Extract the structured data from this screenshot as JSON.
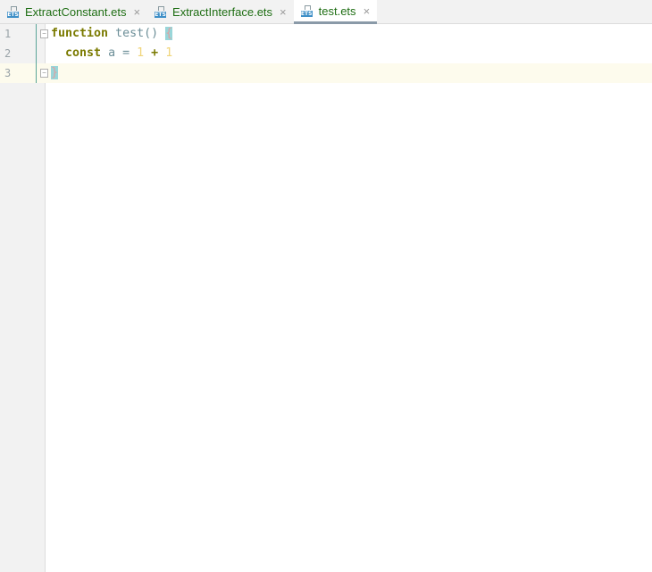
{
  "tabs": [
    {
      "label": "ExtractConstant.ets",
      "icon": "ets-file-icon",
      "active": false
    },
    {
      "label": "ExtractInterface.ets",
      "icon": "ets-file-icon",
      "active": false
    },
    {
      "label": "test.ets",
      "icon": "ets-file-icon",
      "active": true
    }
  ],
  "icon_label": "ETS",
  "close_glyph": "×",
  "editor": {
    "line_numbers": [
      "1",
      "2",
      "3"
    ],
    "code": {
      "l1_kw": "function",
      "l1_name": "test",
      "l1_paren": "()",
      "l1_brace": "{",
      "l2_kw": "const",
      "l2_var": "a",
      "l2_eq": "=",
      "l2_n1": "1",
      "l2_plus": "+",
      "l2_n2": "1",
      "l3_brace": "}"
    }
  }
}
